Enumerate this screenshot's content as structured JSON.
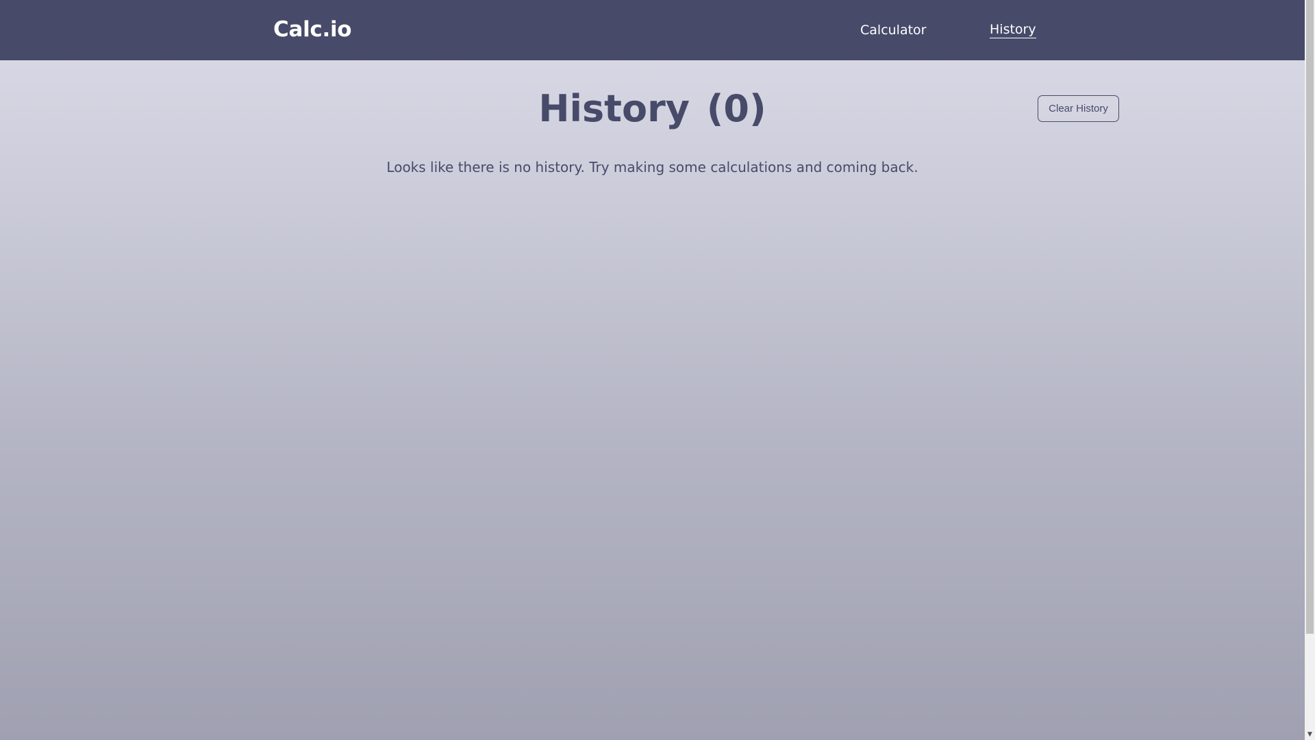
{
  "navbar": {
    "brand": "Calc.io",
    "links": [
      {
        "label": "Calculator",
        "active": false
      },
      {
        "label": "History",
        "active": true
      }
    ]
  },
  "main": {
    "title": "History",
    "count": "(0)",
    "clear_button_label": "Clear History",
    "empty_message": "Looks like there is no history. Try making some calculations and coming back."
  },
  "scrollbar": {
    "up_arrow_icon": "chevron-up-icon",
    "down_arrow_icon": "chevron-down-icon",
    "up_glyph": "▲",
    "down_glyph": "▼"
  },
  "colors": {
    "navbar_bg": "#474a69",
    "primary_text": "#474a69",
    "nav_text": "#ffffff",
    "gradient_top": "#dcdce9",
    "gradient_bottom": "#9fa0b1"
  }
}
